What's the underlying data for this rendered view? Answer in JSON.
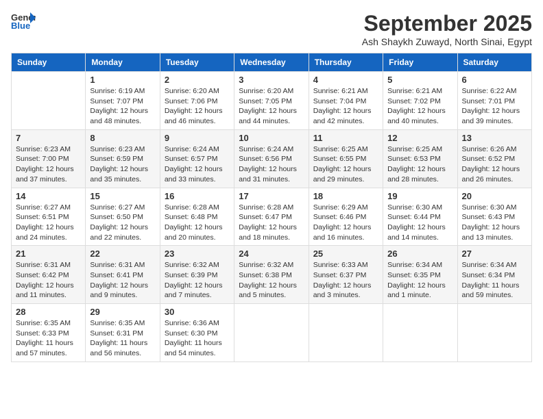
{
  "header": {
    "logo_general": "General",
    "logo_blue": "Blue",
    "month_title": "September 2025",
    "subtitle": "Ash Shaykh Zuwayd, North Sinai, Egypt"
  },
  "columns": [
    "Sunday",
    "Monday",
    "Tuesday",
    "Wednesday",
    "Thursday",
    "Friday",
    "Saturday"
  ],
  "weeks": [
    [
      {
        "day": "",
        "sunrise": "",
        "sunset": "",
        "daylight": ""
      },
      {
        "day": "1",
        "sunrise": "Sunrise: 6:19 AM",
        "sunset": "Sunset: 7:07 PM",
        "daylight": "Daylight: 12 hours and 48 minutes."
      },
      {
        "day": "2",
        "sunrise": "Sunrise: 6:20 AM",
        "sunset": "Sunset: 7:06 PM",
        "daylight": "Daylight: 12 hours and 46 minutes."
      },
      {
        "day": "3",
        "sunrise": "Sunrise: 6:20 AM",
        "sunset": "Sunset: 7:05 PM",
        "daylight": "Daylight: 12 hours and 44 minutes."
      },
      {
        "day": "4",
        "sunrise": "Sunrise: 6:21 AM",
        "sunset": "Sunset: 7:04 PM",
        "daylight": "Daylight: 12 hours and 42 minutes."
      },
      {
        "day": "5",
        "sunrise": "Sunrise: 6:21 AM",
        "sunset": "Sunset: 7:02 PM",
        "daylight": "Daylight: 12 hours and 40 minutes."
      },
      {
        "day": "6",
        "sunrise": "Sunrise: 6:22 AM",
        "sunset": "Sunset: 7:01 PM",
        "daylight": "Daylight: 12 hours and 39 minutes."
      }
    ],
    [
      {
        "day": "7",
        "sunrise": "Sunrise: 6:23 AM",
        "sunset": "Sunset: 7:00 PM",
        "daylight": "Daylight: 12 hours and 37 minutes."
      },
      {
        "day": "8",
        "sunrise": "Sunrise: 6:23 AM",
        "sunset": "Sunset: 6:59 PM",
        "daylight": "Daylight: 12 hours and 35 minutes."
      },
      {
        "day": "9",
        "sunrise": "Sunrise: 6:24 AM",
        "sunset": "Sunset: 6:57 PM",
        "daylight": "Daylight: 12 hours and 33 minutes."
      },
      {
        "day": "10",
        "sunrise": "Sunrise: 6:24 AM",
        "sunset": "Sunset: 6:56 PM",
        "daylight": "Daylight: 12 hours and 31 minutes."
      },
      {
        "day": "11",
        "sunrise": "Sunrise: 6:25 AM",
        "sunset": "Sunset: 6:55 PM",
        "daylight": "Daylight: 12 hours and 29 minutes."
      },
      {
        "day": "12",
        "sunrise": "Sunrise: 6:25 AM",
        "sunset": "Sunset: 6:53 PM",
        "daylight": "Daylight: 12 hours and 28 minutes."
      },
      {
        "day": "13",
        "sunrise": "Sunrise: 6:26 AM",
        "sunset": "Sunset: 6:52 PM",
        "daylight": "Daylight: 12 hours and 26 minutes."
      }
    ],
    [
      {
        "day": "14",
        "sunrise": "Sunrise: 6:27 AM",
        "sunset": "Sunset: 6:51 PM",
        "daylight": "Daylight: 12 hours and 24 minutes."
      },
      {
        "day": "15",
        "sunrise": "Sunrise: 6:27 AM",
        "sunset": "Sunset: 6:50 PM",
        "daylight": "Daylight: 12 hours and 22 minutes."
      },
      {
        "day": "16",
        "sunrise": "Sunrise: 6:28 AM",
        "sunset": "Sunset: 6:48 PM",
        "daylight": "Daylight: 12 hours and 20 minutes."
      },
      {
        "day": "17",
        "sunrise": "Sunrise: 6:28 AM",
        "sunset": "Sunset: 6:47 PM",
        "daylight": "Daylight: 12 hours and 18 minutes."
      },
      {
        "day": "18",
        "sunrise": "Sunrise: 6:29 AM",
        "sunset": "Sunset: 6:46 PM",
        "daylight": "Daylight: 12 hours and 16 minutes."
      },
      {
        "day": "19",
        "sunrise": "Sunrise: 6:30 AM",
        "sunset": "Sunset: 6:44 PM",
        "daylight": "Daylight: 12 hours and 14 minutes."
      },
      {
        "day": "20",
        "sunrise": "Sunrise: 6:30 AM",
        "sunset": "Sunset: 6:43 PM",
        "daylight": "Daylight: 12 hours and 13 minutes."
      }
    ],
    [
      {
        "day": "21",
        "sunrise": "Sunrise: 6:31 AM",
        "sunset": "Sunset: 6:42 PM",
        "daylight": "Daylight: 12 hours and 11 minutes."
      },
      {
        "day": "22",
        "sunrise": "Sunrise: 6:31 AM",
        "sunset": "Sunset: 6:41 PM",
        "daylight": "Daylight: 12 hours and 9 minutes."
      },
      {
        "day": "23",
        "sunrise": "Sunrise: 6:32 AM",
        "sunset": "Sunset: 6:39 PM",
        "daylight": "Daylight: 12 hours and 7 minutes."
      },
      {
        "day": "24",
        "sunrise": "Sunrise: 6:32 AM",
        "sunset": "Sunset: 6:38 PM",
        "daylight": "Daylight: 12 hours and 5 minutes."
      },
      {
        "day": "25",
        "sunrise": "Sunrise: 6:33 AM",
        "sunset": "Sunset: 6:37 PM",
        "daylight": "Daylight: 12 hours and 3 minutes."
      },
      {
        "day": "26",
        "sunrise": "Sunrise: 6:34 AM",
        "sunset": "Sunset: 6:35 PM",
        "daylight": "Daylight: 12 hours and 1 minute."
      },
      {
        "day": "27",
        "sunrise": "Sunrise: 6:34 AM",
        "sunset": "Sunset: 6:34 PM",
        "daylight": "Daylight: 11 hours and 59 minutes."
      }
    ],
    [
      {
        "day": "28",
        "sunrise": "Sunrise: 6:35 AM",
        "sunset": "Sunset: 6:33 PM",
        "daylight": "Daylight: 11 hours and 57 minutes."
      },
      {
        "day": "29",
        "sunrise": "Sunrise: 6:35 AM",
        "sunset": "Sunset: 6:31 PM",
        "daylight": "Daylight: 11 hours and 56 minutes."
      },
      {
        "day": "30",
        "sunrise": "Sunrise: 6:36 AM",
        "sunset": "Sunset: 6:30 PM",
        "daylight": "Daylight: 11 hours and 54 minutes."
      },
      {
        "day": "",
        "sunrise": "",
        "sunset": "",
        "daylight": ""
      },
      {
        "day": "",
        "sunrise": "",
        "sunset": "",
        "daylight": ""
      },
      {
        "day": "",
        "sunrise": "",
        "sunset": "",
        "daylight": ""
      },
      {
        "day": "",
        "sunrise": "",
        "sunset": "",
        "daylight": ""
      }
    ]
  ]
}
